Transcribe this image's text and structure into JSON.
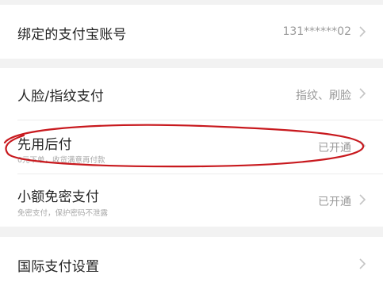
{
  "settings": {
    "alipay_account": {
      "title": "绑定的支付宝账号",
      "value": "131******02",
      "chevron_icon": "chevron-right-icon"
    },
    "face_fingerprint": {
      "title": "人脸/指纹支付",
      "value": "指纹、刷脸",
      "chevron_icon": "chevron-right-icon"
    },
    "pay_later": {
      "title": "先用后付",
      "subtitle": "0元下单，收货满意再付款",
      "value": "已开通",
      "chevron_icon": "chevron-right-icon"
    },
    "small_amount": {
      "title": "小额免密支付",
      "subtitle": "免密支付，保护密码不泄露",
      "value": "已开通",
      "chevron_icon": "chevron-right-icon"
    },
    "international": {
      "title": "国际支付设置",
      "chevron_icon": "chevron-right-icon"
    }
  },
  "colors": {
    "background": "#f2f2f2",
    "row": "#ffffff",
    "annotation": "#c8191e"
  }
}
